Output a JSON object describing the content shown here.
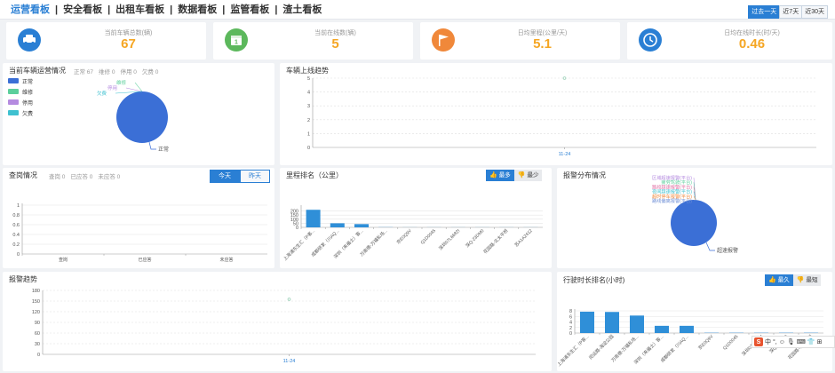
{
  "nav": {
    "tabs": [
      "运营看板",
      "安全看板",
      "出租车看板",
      "数据看板",
      "监管看板",
      "渣土看板"
    ],
    "active": 0,
    "ranges": [
      "过去一天",
      "近7天",
      "近30天"
    ],
    "active_range": 0
  },
  "kpis": [
    {
      "label": "当前车辆总数(辆)",
      "value": "67",
      "icon": "car-icon",
      "color": "#2a7fd4"
    },
    {
      "label": "当前在线数(辆)",
      "value": "5",
      "icon": "calendar-icon",
      "color": "#5cb85c"
    },
    {
      "label": "日均里程(公里/天)",
      "value": "5.1",
      "icon": "flag-icon",
      "color": "#f0883a"
    },
    {
      "label": "日均在线时长(时/天)",
      "value": "0.46",
      "icon": "clock-icon",
      "color": "#2a7fd4"
    }
  ],
  "vehicle_status": {
    "title": "当前车辆运营情况",
    "stats": [
      "正常 67",
      "维修 0",
      "停用 0",
      "欠费 0"
    ],
    "legend": [
      {
        "name": "正常",
        "color": "#3b6fd6"
      },
      {
        "name": "维修",
        "color": "#5ccf9c"
      },
      {
        "name": "停用",
        "color": "#b58be0"
      },
      {
        "name": "欠费",
        "color": "#3fc1d0"
      }
    ]
  },
  "online_trend": {
    "title": "车辆上线趋势"
  },
  "check": {
    "title": "查岗情况",
    "stats": [
      "查岗 0",
      "已应答 0",
      "未应答 0"
    ],
    "buttons": [
      "今天",
      "昨天"
    ]
  },
  "mileage": {
    "title": "里程排名（公里）",
    "buttons": [
      "最多",
      "最少"
    ]
  },
  "alarm_dist": {
    "title": "报警分布情况"
  },
  "alarm_trend": {
    "title": "报警趋势"
  },
  "drive_rank": {
    "title": "行驶时长排名(小时)",
    "buttons": [
      "最久",
      "最短"
    ]
  },
  "ime": {
    "label": "中"
  },
  "chart_data": [
    {
      "type": "pie",
      "title": "当前车辆运营情况",
      "labels": [
        "正常",
        "维修",
        "停用",
        "欠费"
      ],
      "values": [
        67,
        0,
        0,
        0
      ],
      "colors": [
        "#3b6fd6",
        "#5ccf9c",
        "#b58be0",
        "#3fc1d0"
      ],
      "legend": "top-left"
    },
    {
      "type": "line",
      "title": "车辆上线趋势",
      "x": [
        "11-24"
      ],
      "series": [
        {
          "values": [
            5
          ]
        }
      ],
      "ylim": [
        0,
        5
      ],
      "yticks": [
        "0",
        "1",
        "2",
        "3",
        "4",
        "5"
      ],
      "grid": true
    },
    {
      "type": "bar",
      "title": "查岗情况",
      "categories": [
        "查岗",
        "已应答",
        "未应答"
      ],
      "values": [
        0,
        0,
        0
      ],
      "ylim": [
        0,
        1
      ],
      "yticks": [
        "0",
        "0.2",
        "0.4",
        "0.6",
        "0.8",
        "1"
      ]
    },
    {
      "type": "bar",
      "title": "里程排名（公里）",
      "categories": [
        "上海浦东生汇（P客...",
        "成都研发（川AQ...",
        "深圳（来福士）客...",
        "万南德-万福私场...",
        "京E0Q9V",
        "Q1D0045",
        "深圳07L6682I",
        "深Q-23DM0",
        "花园路-北太平桥",
        "苏A1A2412"
      ],
      "values": [
        215,
        50,
        40,
        2,
        1,
        1,
        1,
        1,
        1,
        1
      ],
      "ylim": [
        0,
        250
      ],
      "yticks": [
        "0",
        "50",
        "100",
        "150",
        "200"
      ]
    },
    {
      "type": "pie",
      "title": "报警分布情况",
      "labels": [
        "超速报警",
        "区域超速报警(平台)",
        "疲劳驾驶(平台)",
        "路段超速报警(平台)",
        "夜间超速报警(平台)",
        "超时停车报警(平台)",
        "路线偏离报警(平台)"
      ],
      "values": [
        100,
        0,
        0,
        0,
        0,
        0,
        0
      ],
      "colors": [
        "#3b6fd6",
        "#b58be0",
        "#5ccf9c",
        "#e06fa3",
        "#3fc1d0",
        "#f0883a",
        "#6f8fd6"
      ]
    },
    {
      "type": "line",
      "title": "报警趋势",
      "x": [
        "11-24"
      ],
      "series": [
        {
          "values": [
            155
          ]
        }
      ],
      "ylim": [
        0,
        180
      ],
      "yticks": [
        "0",
        "30",
        "60",
        "90",
        "120",
        "150",
        "180"
      ],
      "grid": true
    },
    {
      "type": "bar",
      "title": "行驶时长排名(小时)",
      "categories": [
        "上海浦东生汇（P客...",
        "闵运路-海淀公园",
        "万南德-万福私场...",
        "深圳（来福士）客...",
        "成都研发（川AQ...",
        "京E0Q9V",
        "Q1D0045",
        "深圳07L6682I",
        "深Q-23DM0",
        "花园路-北太平桥"
      ],
      "values": [
        7.7,
        7.6,
        6.3,
        2.6,
        2.6,
        0.1,
        0.1,
        0.1,
        0.1,
        0.1
      ],
      "ylim": [
        0,
        8
      ],
      "yticks": [
        "0",
        "2",
        "4",
        "6",
        "8"
      ]
    }
  ]
}
